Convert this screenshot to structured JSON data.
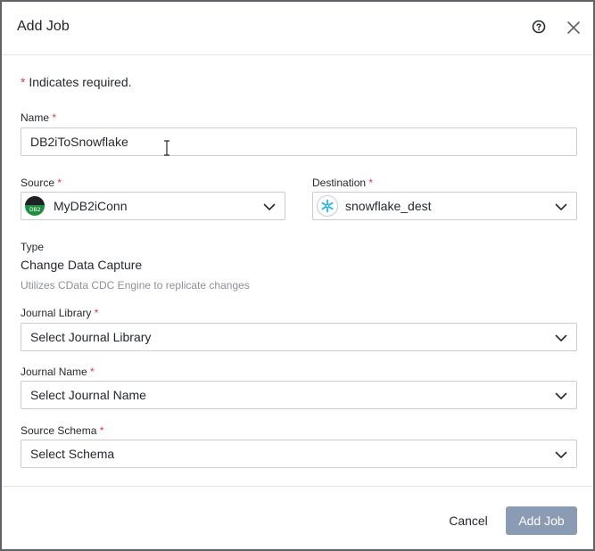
{
  "dialog": {
    "title": "Add Job",
    "required_mark": "*",
    "required_note": "Indicates required."
  },
  "name": {
    "label": "Name",
    "value": "DB2iToSnowflake"
  },
  "source": {
    "label": "Source",
    "value": "MyDB2iConn",
    "icon_text": "DB2",
    "icon": "db2-logo-icon"
  },
  "destination": {
    "label": "Destination",
    "value": "snowflake_dest",
    "icon": "snowflake-icon"
  },
  "type": {
    "label": "Type",
    "value": "Change Data Capture",
    "description": "Utilizes CData CDC Engine to replicate changes"
  },
  "journal_library": {
    "label": "Journal Library",
    "placeholder": "Select Journal Library"
  },
  "journal_name": {
    "label": "Journal Name",
    "placeholder": "Select Journal Name"
  },
  "source_schema": {
    "label": "Source Schema",
    "placeholder": "Select Schema"
  },
  "footer": {
    "cancel_label": "Cancel",
    "add_label": "Add Job"
  },
  "colors": {
    "required": "#d73a49",
    "primary_disabled": "#8b9bb4",
    "snowflake": "#29b5e8",
    "db2_green": "#1e8e3e"
  }
}
